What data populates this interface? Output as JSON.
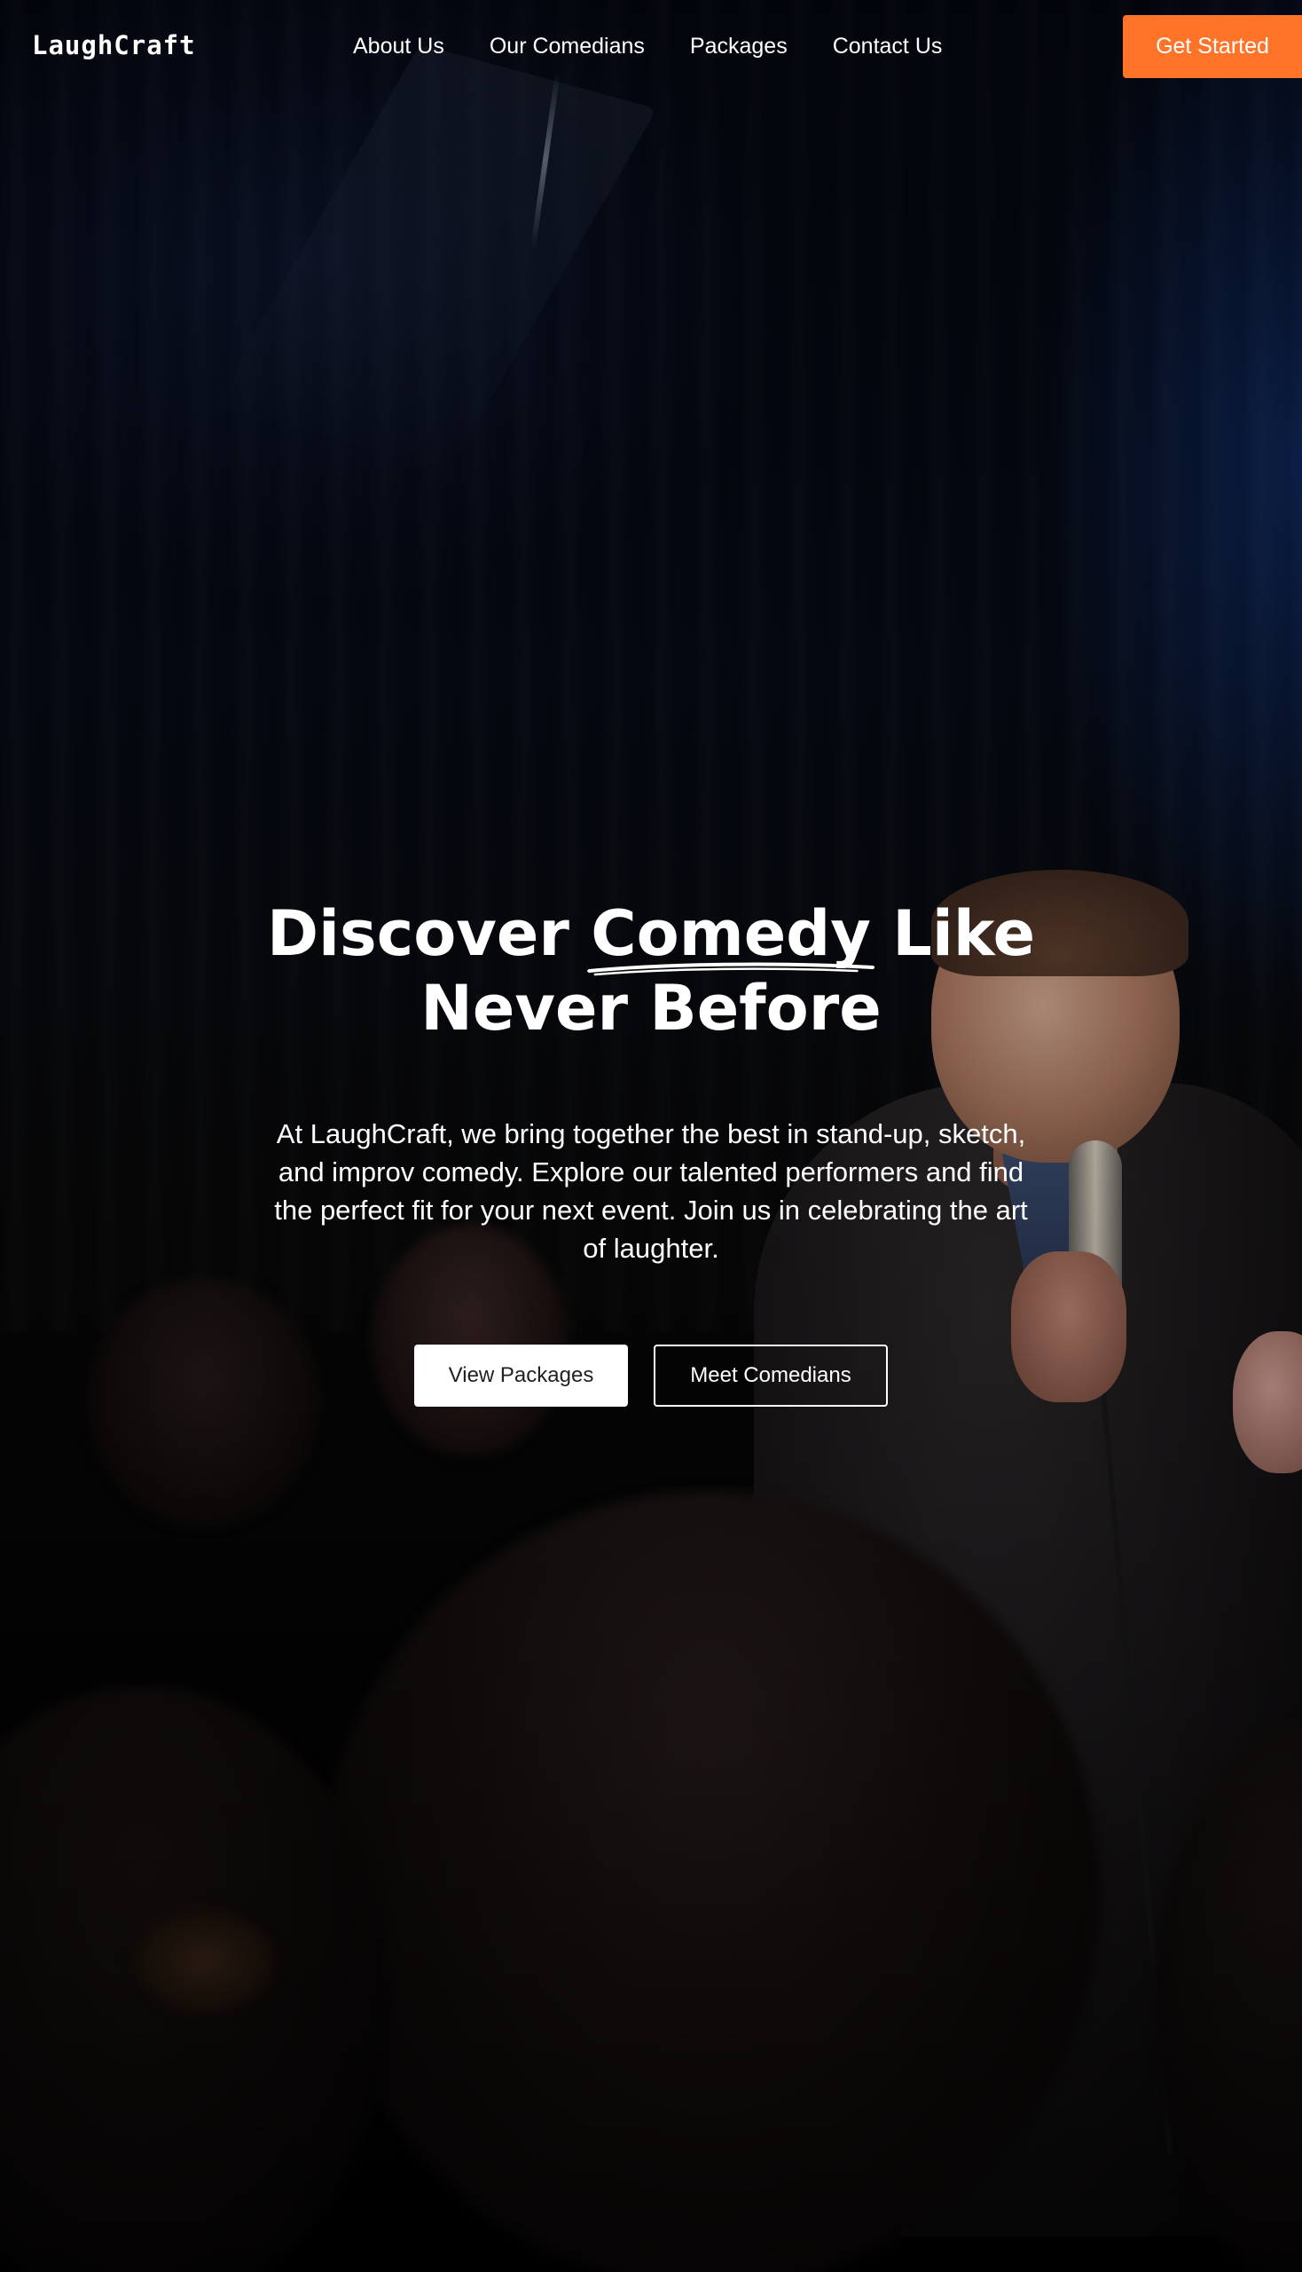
{
  "brand": {
    "logo_text": "LaughCraft",
    "accent_color": "#ff7428"
  },
  "nav": {
    "links": [
      {
        "label": "About Us"
      },
      {
        "label": "Our Comedians"
      },
      {
        "label": "Packages"
      },
      {
        "label": "Contact Us"
      }
    ],
    "cta_label": "Get Started"
  },
  "hero": {
    "headline_before": "Discover ",
    "headline_accent": "Comedy",
    "headline_after": " Like Never Before",
    "description": "At LaughCraft, we bring together the best in stand-up, sketch, and improv comedy. Explore our talented performers and find the perfect fit for your next event. Join us in celebrating the art of laughter.",
    "primary_button": "View Packages",
    "secondary_button": "Meet Comedians",
    "background_image": "comedian-on-stage-photo"
  }
}
